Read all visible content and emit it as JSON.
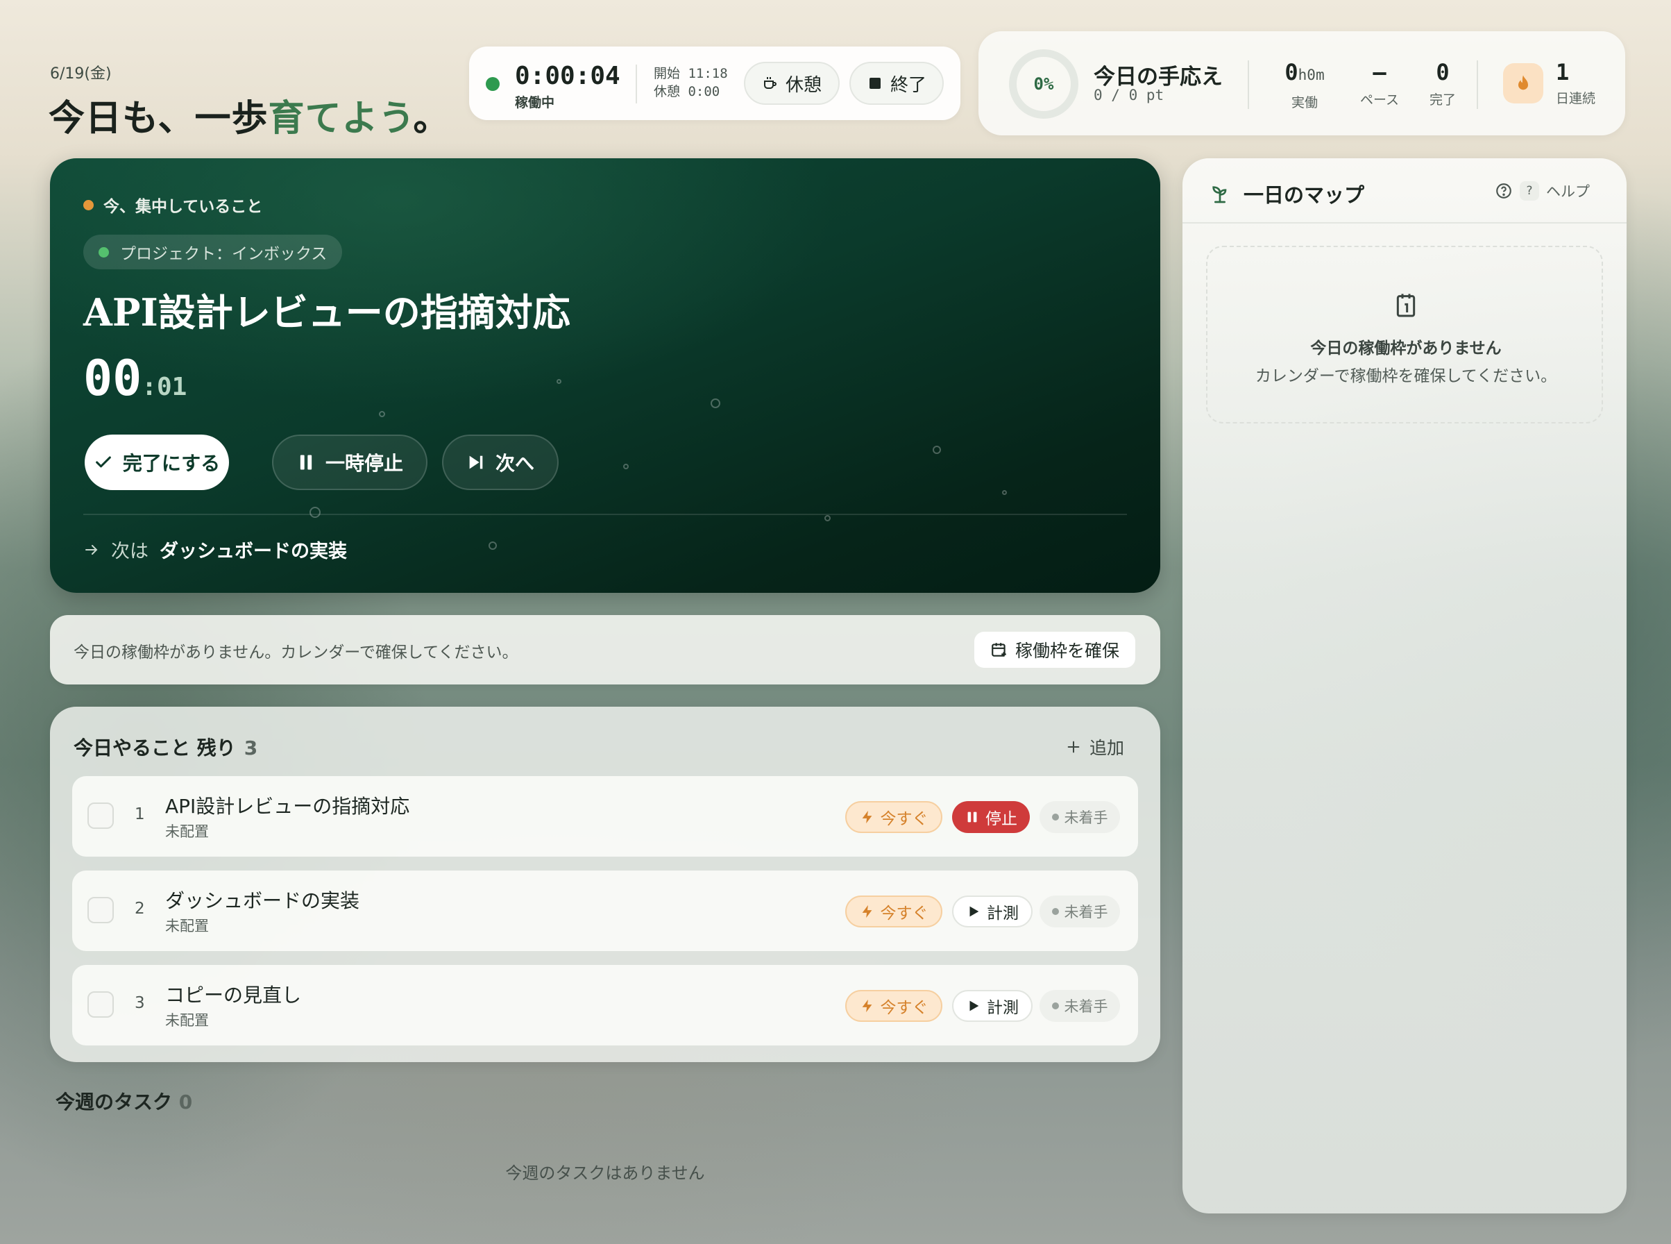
{
  "header": {
    "date": "6/19(金)",
    "tagline_prefix": "今日も、一歩",
    "tagline_accent": "育てよう",
    "tagline_suffix": "。"
  },
  "timer": {
    "elapsed": "0:00:04",
    "status": "稼働中",
    "start_label": "開始 11:18",
    "break_label": "休憩 0:00",
    "break_button": "休憩",
    "end_button": "終了"
  },
  "stats": {
    "progress_percent": "0%",
    "title": "今日の手応え",
    "points": "0 / 0 pt",
    "actual_value": "0",
    "actual_unit": "h0m",
    "actual_label": "実働",
    "pace_value": "–",
    "pace_label": "ペース",
    "done_value": "0",
    "done_label": "完了",
    "streak_value": "1",
    "streak_label": "日連続"
  },
  "focus": {
    "label": "今、集中していること",
    "project": "プロジェクト：インボックス",
    "title": "API設計レビューの指摘対応",
    "time_main": "00",
    "time_sub": ":01",
    "done_button": "完了にする",
    "pause_button": "一時停止",
    "next_button": "次へ",
    "next_prefix": "次は",
    "next_task": "ダッシュボードの実装"
  },
  "alert": {
    "text": "今日の稼働枠がありません。カレンダーで確保してください。",
    "button": "稼働枠を確保"
  },
  "todo": {
    "title": "今日やること 残り",
    "count": "3",
    "add": "追加",
    "items": [
      {
        "index": "1",
        "name": "API設計レビューの指摘対応",
        "sub": "未配置",
        "priority": "今すぐ",
        "action": "停止",
        "state": "未着手"
      },
      {
        "index": "2",
        "name": "ダッシュボードの実装",
        "sub": "未配置",
        "priority": "今すぐ",
        "action": "計測",
        "state": "未着手"
      },
      {
        "index": "3",
        "name": "コピーの見直し",
        "sub": "未配置",
        "priority": "今すぐ",
        "action": "計測",
        "state": "未着手"
      }
    ]
  },
  "week": {
    "title": "今週のタスク",
    "count": "0",
    "empty": "今週のタスクはありません"
  },
  "daymap": {
    "title": "一日のマップ",
    "help_key": "?",
    "help": "ヘルプ",
    "empty_title": "今日の稼働枠がありません",
    "empty_sub": "カレンダーで稼働枠を確保してください。"
  },
  "colors": {
    "accent_green": "#3c7a4e",
    "focus_bg": "#0b3a2b",
    "stop_red": "#cf3b3b",
    "now_orange": "#d5812a"
  }
}
